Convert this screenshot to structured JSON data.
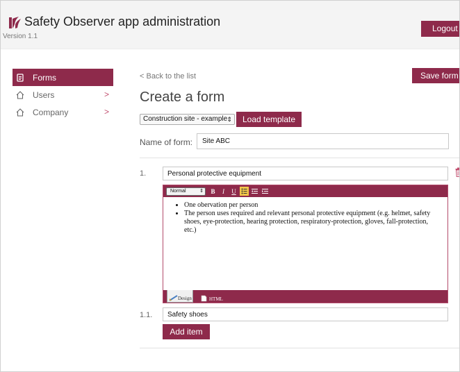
{
  "header": {
    "title": "Safety Observer app administration",
    "version": "Version 1.1",
    "logout_label": "Logout"
  },
  "sidebar": {
    "items": [
      {
        "label": "Forms",
        "icon": "forms-icon",
        "active": true
      },
      {
        "label": "Users",
        "icon": "home-outline-icon",
        "chevron": ">"
      },
      {
        "label": "Company",
        "icon": "home-outline-icon",
        "chevron": ">"
      }
    ]
  },
  "main": {
    "back_label": "< Back to the list",
    "save_label": "Save form",
    "title": "Create a form",
    "template_select": {
      "selected": "Construction site - example",
      "arrows": "⇕"
    },
    "load_template_label": "Load template",
    "name_label": "Name of form:",
    "name_value": "Site ABC",
    "items": [
      {
        "number": "1.",
        "value": "Personal protective equipment",
        "editor": {
          "format_select": "Normal",
          "bullets": [
            "One obervation per person",
            "The person uses required and relevant personal protective equipment (e.g. helmet, safety shoes, eye-protection, hearing protection, respiratory-protection, gloves, fall-protection, etc.)"
          ],
          "tab_design": "Design",
          "tab_html": "HTML"
        }
      },
      {
        "number": "1.1.",
        "value": "Safety shoes"
      }
    ],
    "add_item_label": "Add item"
  },
  "colors": {
    "accent": "#8e2a4b",
    "chevron": "#c24f6f",
    "toolbar_highlight": "#f3c64a"
  }
}
